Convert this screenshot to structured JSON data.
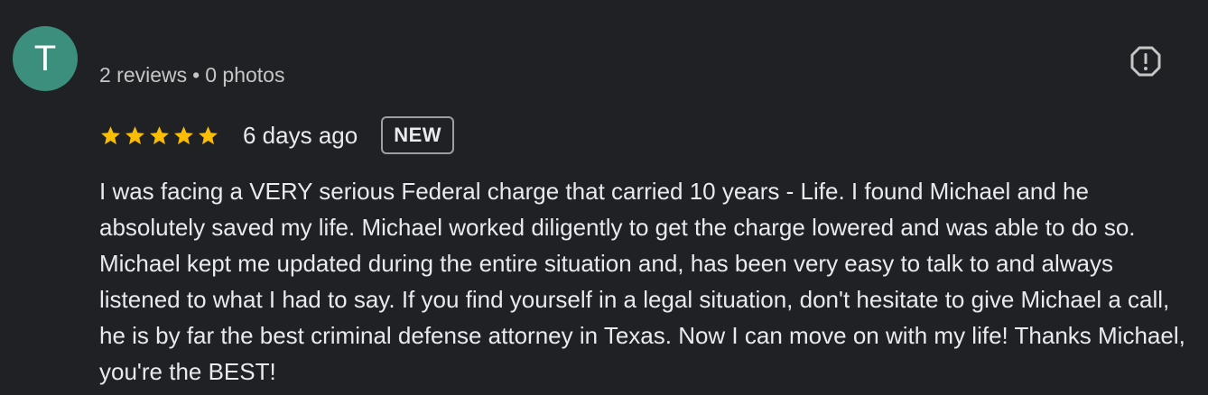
{
  "reviewer": {
    "initial": "T",
    "avatar_color": "#3d8f7d",
    "name": "",
    "reviews_count": "2 reviews",
    "separator": "•",
    "photos_count": "0 photos"
  },
  "review": {
    "rating": 5,
    "max_rating": 5,
    "star_color": "#fbbc04",
    "date": "6 days ago",
    "badge": "NEW",
    "text": "I was facing a VERY serious Federal charge that carried 10 years - Life. I found Michael and he absolutely saved my life. Michael worked diligently to get the charge lowered and was able to do so. Michael kept me updated during the entire situation and, has been very easy to talk to and always listened to what I had to say. If you find yourself in a legal situation, don't hesitate to give Michael a call, he is by far the best criminal defense attorney in Texas. Now I can move on with my life! Thanks Michael, you're the BEST!"
  },
  "actions": {
    "report_icon": "report-octagon-icon"
  }
}
